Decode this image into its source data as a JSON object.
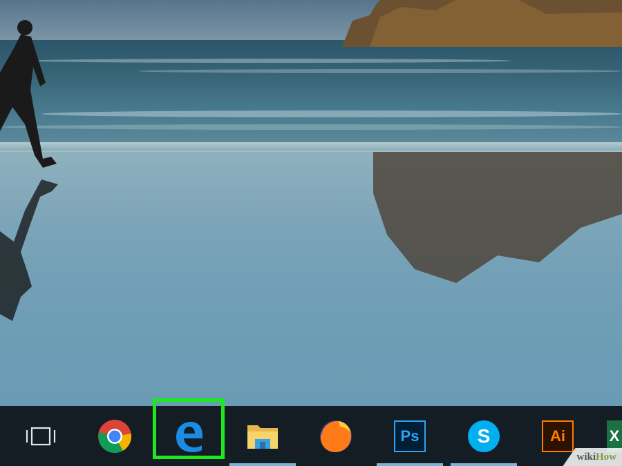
{
  "taskbar": {
    "items": [
      {
        "name": "task-view",
        "icon": "task-view-icon",
        "running": false
      },
      {
        "name": "chrome",
        "icon": "chrome-icon",
        "running": false
      },
      {
        "name": "edge",
        "icon": "edge-icon",
        "running": false,
        "highlighted": true
      },
      {
        "name": "file-explorer",
        "icon": "folder-icon",
        "running": true
      },
      {
        "name": "firefox",
        "icon": "firefox-icon",
        "running": false
      },
      {
        "name": "photoshop",
        "icon": "photoshop-icon",
        "label": "Ps",
        "running": true
      },
      {
        "name": "skype",
        "icon": "skype-icon",
        "label": "S",
        "running": true
      },
      {
        "name": "illustrator",
        "icon": "illustrator-icon",
        "label": "Ai",
        "running": false
      },
      {
        "name": "excel",
        "icon": "excel-icon",
        "label": "X",
        "running": false
      }
    ],
    "colors": {
      "highlight": "#1ee81e",
      "edge": "#1a8ce3",
      "photoshop": "#2ea3f2",
      "illustrator": "#ff7c00",
      "skype": "#00aff0",
      "excel": "#1d7044"
    }
  },
  "watermark": {
    "wiki": "wiki",
    "how": "How"
  }
}
